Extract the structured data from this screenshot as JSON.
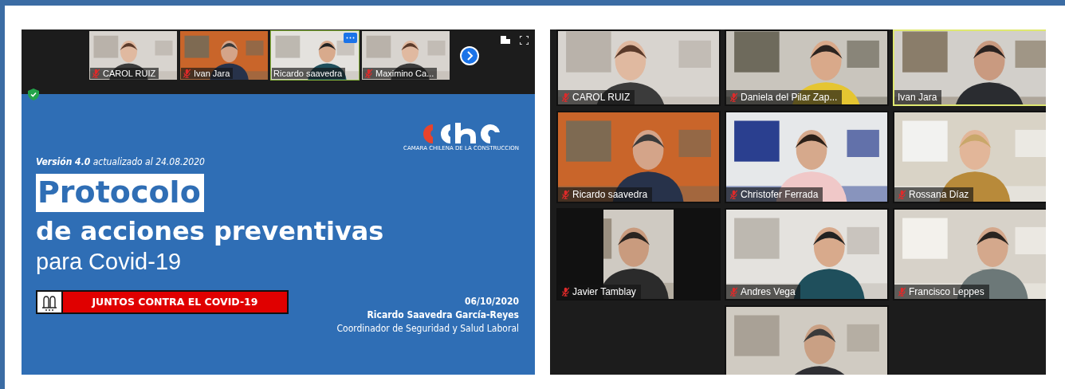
{
  "presentation": {
    "thumbnails": [
      {
        "name": "CAROL RUIZ",
        "muted": true,
        "speaking": false
      },
      {
        "name": "Ivan Jara",
        "muted": true,
        "speaking": false
      },
      {
        "name": "Ricardo saavedra",
        "muted": false,
        "speaking": true
      },
      {
        "name": "Maximino Ca...",
        "muted": true,
        "speaking": false
      }
    ],
    "slide": {
      "logo_caption": "CAMARA CHILENA DE LA CONSTRUCCION",
      "version": "**Versión 4.0** actualizado al 24.08.2020",
      "title": "Protocolo",
      "subtitle": "de acciones preventivas",
      "subtitle2": "para Covid-19",
      "banner": "JUNTOS CONTRA EL COVID-19",
      "date": "06/10/2020",
      "author": "Ricardo Saavedra García-Reyes",
      "role": "Coordinador de Seguridad y Salud Laboral"
    }
  },
  "gallery": {
    "tiles": [
      {
        "name": "CAROL RUIZ",
        "muted": true,
        "speaking": false,
        "pillarboxed": false
      },
      {
        "name": "Daniela del Pilar Zap...",
        "muted": true,
        "speaking": false,
        "pillarboxed": false
      },
      {
        "name": "Ivan Jara",
        "muted": false,
        "speaking": true,
        "pillarboxed": false
      },
      {
        "name": "Ricardo saavedra",
        "muted": true,
        "speaking": false,
        "pillarboxed": false
      },
      {
        "name": "Christofer Ferrada",
        "muted": true,
        "speaking": false,
        "pillarboxed": false
      },
      {
        "name": "Rossana Díaz",
        "muted": true,
        "speaking": false,
        "pillarboxed": false
      },
      {
        "name": "Javier Tamblay",
        "muted": true,
        "speaking": false,
        "pillarboxed": true
      },
      {
        "name": "Andres Vega",
        "muted": true,
        "speaking": false,
        "pillarboxed": false
      },
      {
        "name": "Francisco Leppes",
        "muted": true,
        "speaking": false,
        "pillarboxed": false
      },
      {
        "speaking": false,
        "pillarboxed": false
      }
    ]
  }
}
